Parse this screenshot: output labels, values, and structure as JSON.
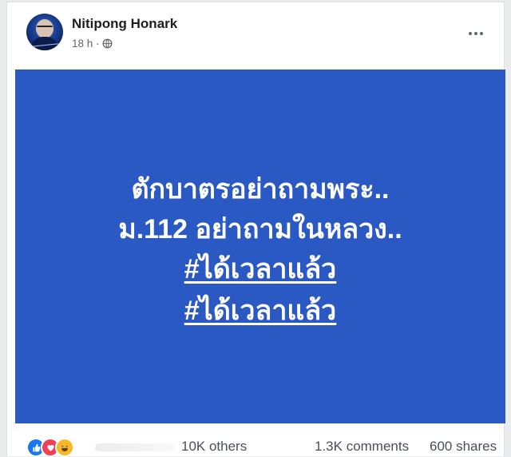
{
  "author": {
    "name": "Nitipong Honark"
  },
  "meta": {
    "time": "18 h ·",
    "audience_icon": "globe-icon"
  },
  "menu": {
    "icon": "more-options-icon"
  },
  "post": {
    "background": "#2b59c3",
    "lines": [
      "ตักบาตรอย่าถามพระ..",
      "ม.112 อย่าถามในหลวง.."
    ],
    "hashtags": [
      "#ได้เวลาแล้ว",
      "#ได้เวลาแล้ว"
    ]
  },
  "stats": {
    "reactions": [
      "like-icon",
      "love-icon",
      "haha-icon"
    ],
    "reaction_count": "10K others",
    "comments": "1.3K comments",
    "shares": "600 shares"
  },
  "colors": {
    "like": "#1877f2",
    "love": "#f33e58",
    "haha": "#f7b928"
  }
}
